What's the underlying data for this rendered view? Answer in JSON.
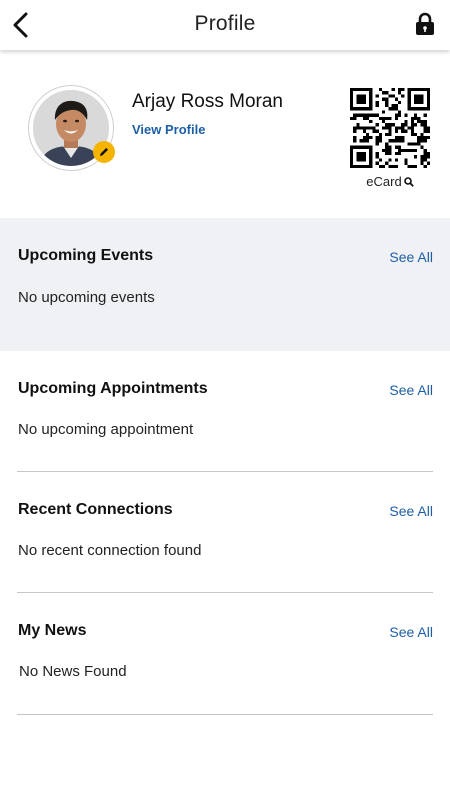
{
  "header": {
    "title": "Profile",
    "back_icon": "chevron-left-icon",
    "lock_icon": "lock-icon"
  },
  "profile": {
    "name": "Arjay Ross Moran",
    "view_profile_label": "View Profile",
    "ecard_label": "eCard",
    "edit_icon": "pencil-icon",
    "ecard_icon": "search-icon"
  },
  "sections": [
    {
      "title": "Upcoming Events",
      "see_all": "See All",
      "empty": "No upcoming events"
    },
    {
      "title": "Upcoming Appointments",
      "see_all": "See All",
      "empty": "No upcoming appointment"
    },
    {
      "title": "Recent Connections",
      "see_all": "See All",
      "empty": "No recent connection found"
    },
    {
      "title": "My News",
      "see_all": "See All",
      "empty": "No News Found"
    }
  ],
  "colors": {
    "accent_link": "#1d5fa6",
    "edit_badge": "#f5b400",
    "events_background": "#eff1f4"
  }
}
